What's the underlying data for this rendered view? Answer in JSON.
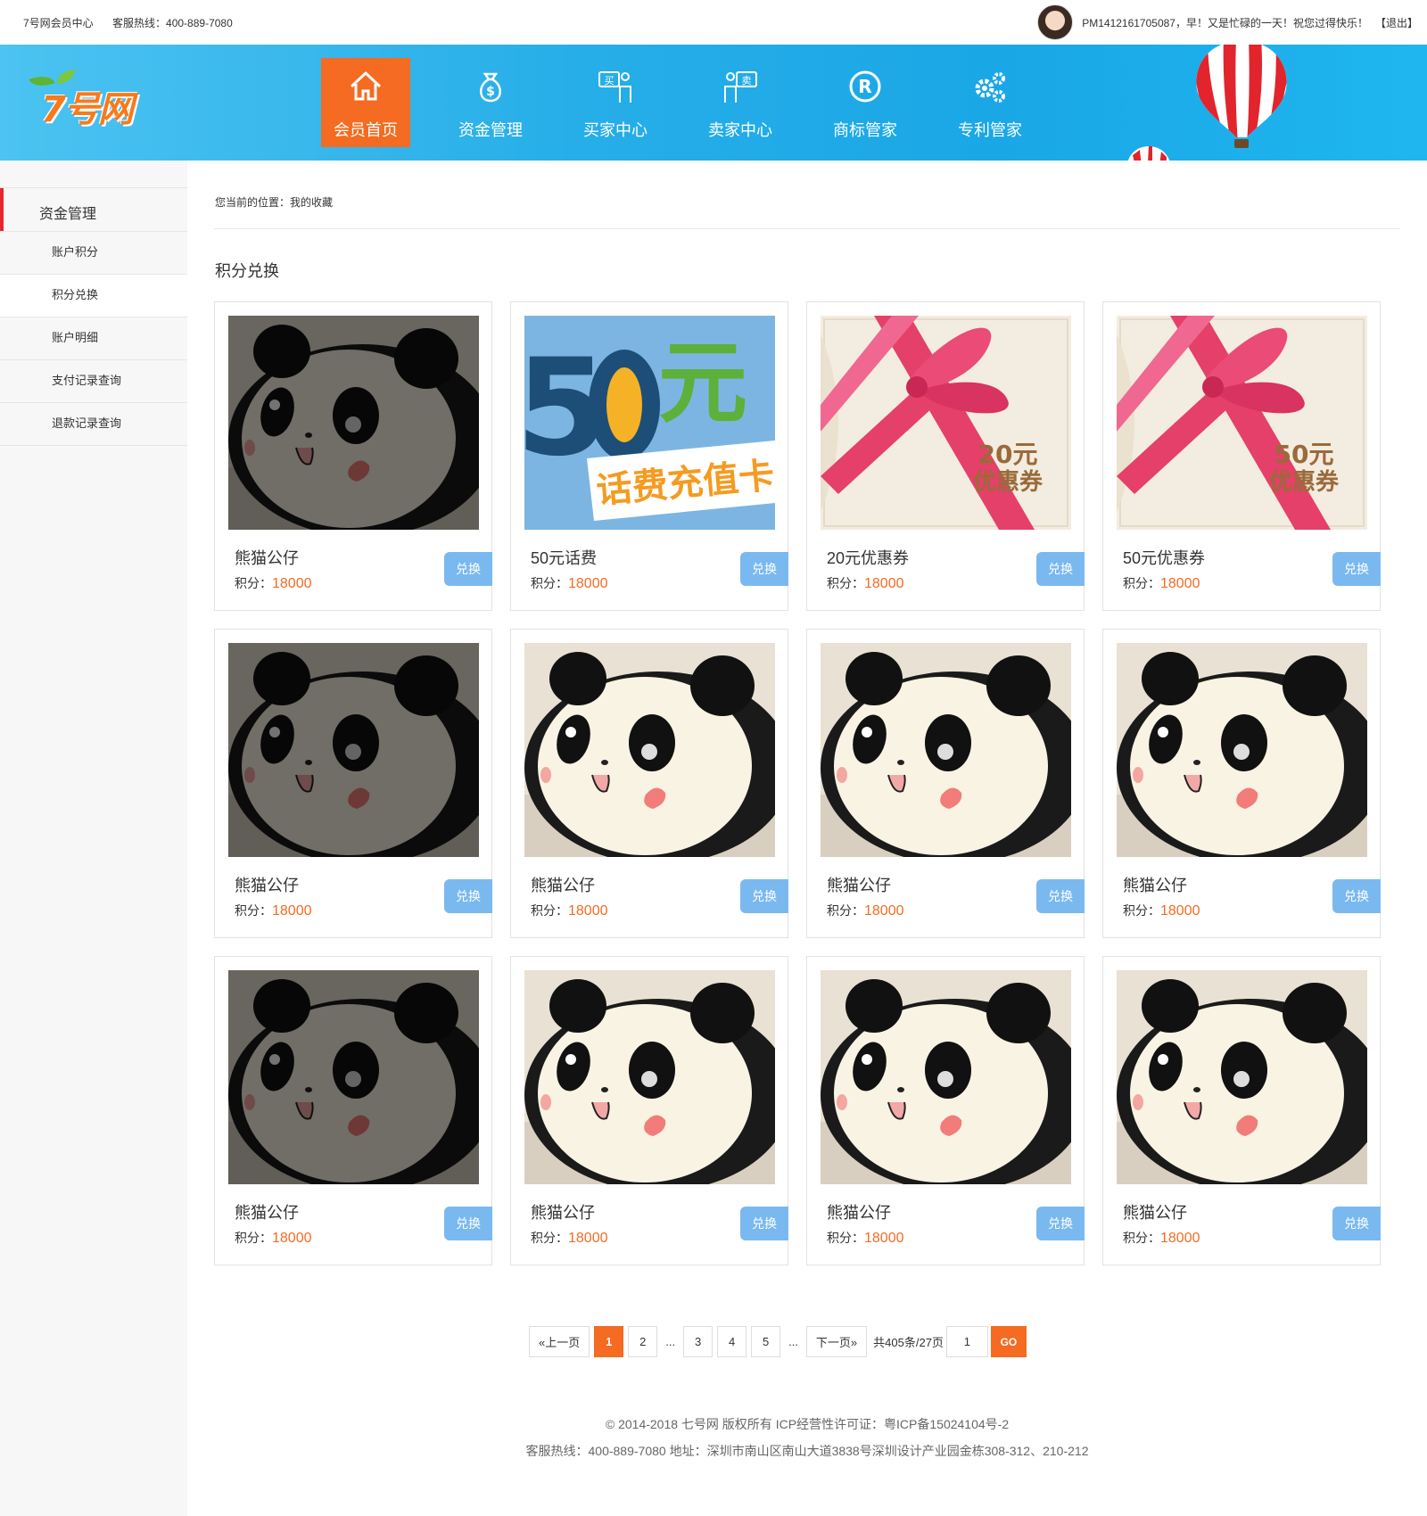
{
  "topbar": {
    "site_center": "7号网会员中心",
    "hotline": "客服热线：400-889-7080",
    "greeting": "PM1412161705087，早！又是忙碌的一天！祝您过得快乐！",
    "logout": "【退出】"
  },
  "logo": {
    "text": "7号网"
  },
  "nav": [
    {
      "label": "会员首页",
      "icon": "home-icon",
      "active": true
    },
    {
      "label": "资金管理",
      "icon": "money-bag-icon",
      "active": false
    },
    {
      "label": "买家中心",
      "icon": "buyer-icon",
      "active": false
    },
    {
      "label": "卖家中心",
      "icon": "seller-icon",
      "active": false
    },
    {
      "label": "商标管家",
      "icon": "registered-icon",
      "active": false
    },
    {
      "label": "专利管家",
      "icon": "gears-icon",
      "active": false
    }
  ],
  "sidebar": {
    "title": "资金管理",
    "items": [
      {
        "label": "账户积分"
      },
      {
        "label": "积分兑换"
      },
      {
        "label": "账户明细"
      },
      {
        "label": "支付记录查询"
      },
      {
        "label": "退款记录查询"
      }
    ]
  },
  "breadcrumb": "您当前的位置：我的收藏",
  "section_title": "积分兑换",
  "points_label": "积分：",
  "exchange_label": "兑换",
  "products": [
    {
      "name": "熊猫公仔",
      "points": "18000",
      "image": "panda",
      "dimmed": true
    },
    {
      "name": "50元话费",
      "points": "18000",
      "image": "phone-card",
      "dimmed": false,
      "image_text_big": "50元",
      "image_text_small": "话费充值卡"
    },
    {
      "name": "20元优惠券",
      "points": "18000",
      "image": "coupon",
      "dimmed": false,
      "image_text_top": "20元",
      "image_text_bottom": "优惠券"
    },
    {
      "name": "50元优惠券",
      "points": "18000",
      "image": "coupon",
      "dimmed": false,
      "image_text_top": "50元",
      "image_text_bottom": "优惠券"
    },
    {
      "name": "熊猫公仔",
      "points": "18000",
      "image": "panda",
      "dimmed": true
    },
    {
      "name": "熊猫公仔",
      "points": "18000",
      "image": "panda",
      "dimmed": false
    },
    {
      "name": "熊猫公仔",
      "points": "18000",
      "image": "panda",
      "dimmed": false
    },
    {
      "name": "熊猫公仔",
      "points": "18000",
      "image": "panda",
      "dimmed": false
    },
    {
      "name": "熊猫公仔",
      "points": "18000",
      "image": "panda",
      "dimmed": true
    },
    {
      "name": "熊猫公仔",
      "points": "18000",
      "image": "panda",
      "dimmed": false
    },
    {
      "name": "熊猫公仔",
      "points": "18000",
      "image": "panda",
      "dimmed": false
    },
    {
      "name": "熊猫公仔",
      "points": "18000",
      "image": "panda",
      "dimmed": false
    }
  ],
  "pagination": {
    "prev": "«上一页",
    "pages": [
      "1",
      "2",
      "...",
      "3",
      "4",
      "5",
      "..."
    ],
    "current": "1",
    "next": "下一页»",
    "total": "共405条/27页",
    "input_value": "1",
    "go": "GO"
  },
  "footer": {
    "line1": "© 2014-2018 七号网 版权所有 ICP经营性许可证：粤ICP备15024104号-2",
    "line2": "客服热线：400-889-7080  地址：深圳市南山区南山大道3838号深圳设计产业园金栋308-312、210-212"
  },
  "colors": {
    "accent": "#f46b21",
    "banner_blue": "#1aa7e6",
    "button_blue": "#7ab9f0",
    "sidebar_marker": "#e8262c"
  }
}
